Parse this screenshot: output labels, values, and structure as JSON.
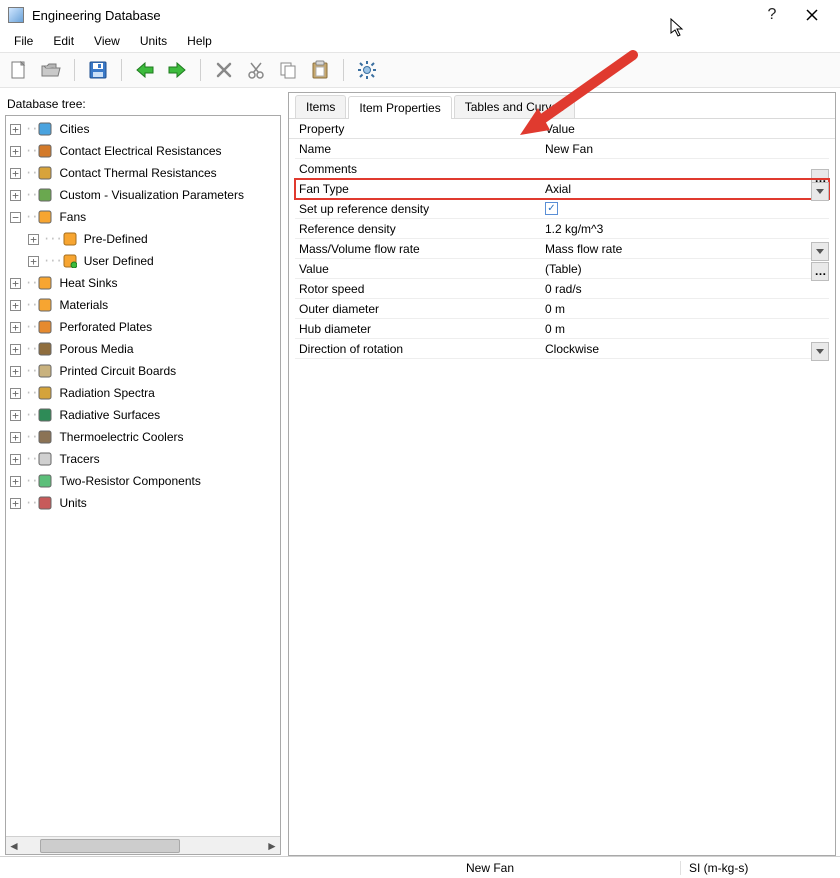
{
  "window": {
    "title": "Engineering Database"
  },
  "menus": {
    "file": "File",
    "edit": "Edit",
    "view": "View",
    "units": "Units",
    "help": "Help"
  },
  "tree": {
    "label": "Database tree:",
    "items": [
      {
        "label": "Cities"
      },
      {
        "label": "Contact Electrical Resistances"
      },
      {
        "label": "Contact Thermal Resistances"
      },
      {
        "label": "Custom - Visualization Parameters"
      },
      {
        "label": "Fans",
        "children": [
          {
            "label": "Pre-Defined"
          },
          {
            "label": "User Defined"
          }
        ]
      },
      {
        "label": "Heat Sinks"
      },
      {
        "label": "Materials"
      },
      {
        "label": "Perforated Plates"
      },
      {
        "label": "Porous Media"
      },
      {
        "label": "Printed Circuit Boards"
      },
      {
        "label": "Radiation Spectra"
      },
      {
        "label": "Radiative Surfaces"
      },
      {
        "label": "Thermoelectric Coolers"
      },
      {
        "label": "Tracers"
      },
      {
        "label": "Two-Resistor Components"
      },
      {
        "label": "Units"
      }
    ]
  },
  "tabs": {
    "items": "Items",
    "item_properties": "Item Properties",
    "tables_curves": "Tables and Curves"
  },
  "props": {
    "header_property": "Property",
    "header_value": "Value",
    "rows": [
      {
        "prop": "Name",
        "val": "New Fan"
      },
      {
        "prop": "Comments",
        "val": "",
        "btn": "dots"
      },
      {
        "prop": "Fan Type",
        "val": "Axial",
        "btn": "dd",
        "hl": true
      },
      {
        "prop": "Set up reference density",
        "val": "",
        "chk": true
      },
      {
        "prop": "Reference density",
        "val": "1.2 kg/m^3"
      },
      {
        "prop": "Mass/Volume flow rate",
        "val": "Mass flow rate",
        "btn": "dd"
      },
      {
        "prop": "Value",
        "val": "(Table)",
        "btn": "dots"
      },
      {
        "prop": "Rotor speed",
        "val": "0 rad/s"
      },
      {
        "prop": "Outer diameter",
        "val": "0 m"
      },
      {
        "prop": "Hub diameter",
        "val": "0 m"
      },
      {
        "prop": "Direction of rotation",
        "val": "Clockwise",
        "btn": "dd"
      }
    ]
  },
  "status": {
    "name": "New Fan",
    "units": "SI (m-kg-s)"
  }
}
